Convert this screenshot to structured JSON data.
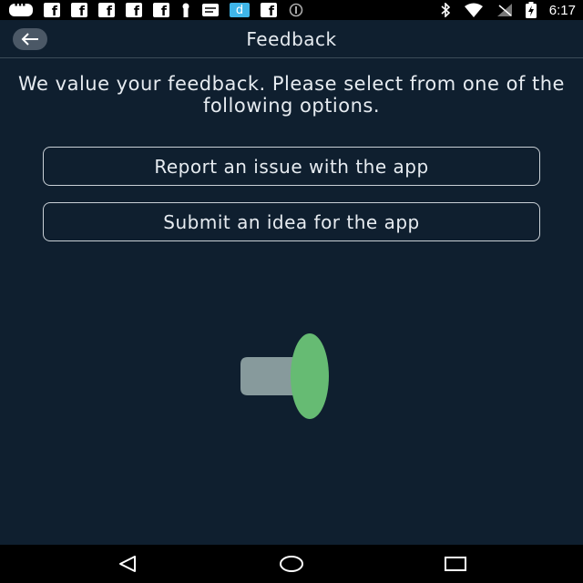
{
  "status_bar": {
    "time": "6:17",
    "left_icons": [
      "message-icon",
      "facebook-icon",
      "facebook-icon",
      "facebook-icon",
      "facebook-icon",
      "facebook-icon",
      "keyhole-icon",
      "message-icon",
      "d-app-icon",
      "facebook-icon",
      "circle-icon"
    ],
    "d_icon_label": "d",
    "right_icons": [
      "bluetooth-icon",
      "wifi-icon",
      "no-signal-icon",
      "battery-charging-icon"
    ]
  },
  "header": {
    "title": "Feedback",
    "back_icon": "arrow-left-icon"
  },
  "main": {
    "intro_text": "We value your feedback. Please select from one of the following options.",
    "options": [
      {
        "label": "Report an issue with the app"
      },
      {
        "label": "Submit an idea for the app"
      }
    ]
  },
  "colors": {
    "background": "#0f1f2f",
    "text": "#e6ebf0",
    "border": "#c9d0d6",
    "toggle_green": "#66bb73",
    "toggle_gray": "#879a9c"
  },
  "nav_bar": {
    "icons": [
      "triangle-back-icon",
      "circle-home-icon",
      "square-recents-icon"
    ]
  }
}
